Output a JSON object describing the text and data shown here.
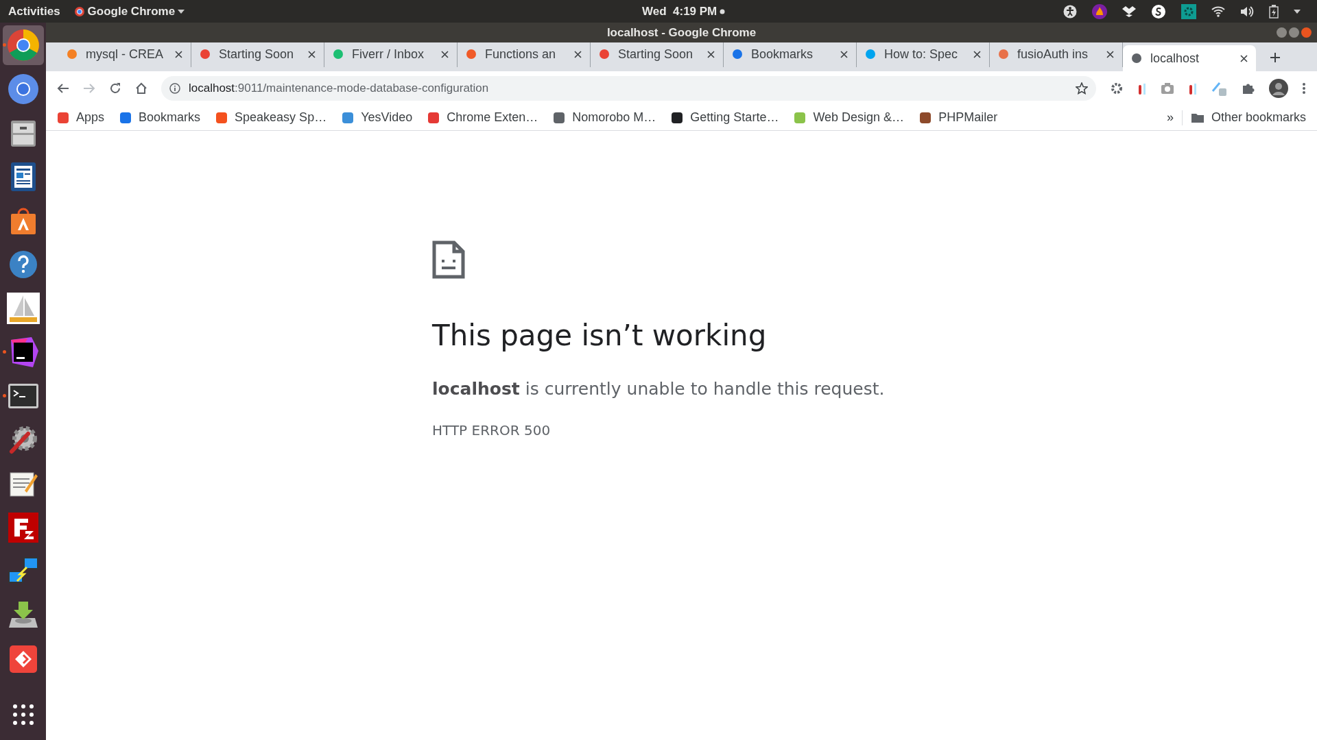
{
  "top_bar": {
    "activities": "Activities",
    "app_menu": "Google Chrome",
    "clock": "Wed  4:19 PM"
  },
  "dock": [
    {
      "kind": "browser",
      "selected": true,
      "running": true
    },
    {
      "kind": "browser2",
      "selected": false,
      "running": false
    },
    {
      "kind": "cabinet",
      "selected": false,
      "running": false
    },
    {
      "kind": "document",
      "selected": false,
      "running": false
    },
    {
      "kind": "store",
      "selected": false,
      "running": false
    },
    {
      "kind": "help",
      "selected": false,
      "running": false
    },
    {
      "kind": "sail",
      "selected": false,
      "running": false
    },
    {
      "kind": "editor",
      "selected": false,
      "running": true
    },
    {
      "kind": "terminal",
      "selected": false,
      "running": true
    },
    {
      "kind": "tools",
      "selected": false,
      "running": false
    },
    {
      "kind": "notepad",
      "selected": false,
      "running": false
    },
    {
      "kind": "ftp",
      "selected": false,
      "running": false
    },
    {
      "kind": "network",
      "selected": false,
      "running": false
    },
    {
      "kind": "download",
      "selected": false,
      "running": false
    },
    {
      "kind": "remote",
      "selected": false,
      "running": false
    },
    {
      "kind": "grid",
      "selected": false,
      "running": false
    }
  ],
  "window": {
    "title": "localhost - Google Chrome"
  },
  "tabs": [
    {
      "label": "mysql - CREA",
      "color": "#f48024",
      "selected": false
    },
    {
      "label": "Starting Soon",
      "color": "#ea4335",
      "selected": false
    },
    {
      "label": "Fiverr / Inbox",
      "color": "#1dbf73",
      "selected": false
    },
    {
      "label": "Functions an",
      "color": "#f05a28",
      "selected": false
    },
    {
      "label": "Starting Soon",
      "color": "#ea4335",
      "selected": false
    },
    {
      "label": "Bookmarks",
      "color": "#1a73e8",
      "selected": false
    },
    {
      "label": "How to: Spec",
      "color": "#00a4ef",
      "selected": false
    },
    {
      "label": "fusioAuth ins",
      "color": "#e8714a",
      "selected": false
    },
    {
      "label": "localhost",
      "color": "#5f6368",
      "selected": true
    }
  ],
  "address_bar": {
    "host": "localhost",
    "path": ":9011/maintenance-mode-database-configuration"
  },
  "bookmarks": [
    {
      "label": "Apps",
      "color": "#ea4335"
    },
    {
      "label": "Bookmarks",
      "color": "#1a73e8"
    },
    {
      "label": "Speakeasy Sp…",
      "color": "#f4511e"
    },
    {
      "label": "YesVideo",
      "color": "#3b8fd9"
    },
    {
      "label": "Chrome Exten…",
      "color": "#e53935"
    },
    {
      "label": "Nomorobo M…",
      "color": "#5f6368"
    },
    {
      "label": "Getting Starte…",
      "color": "#202124"
    },
    {
      "label": "Web Design &…",
      "color": "#8bc34a"
    },
    {
      "label": "PHPMailer",
      "color": "#8d4a2b"
    }
  ],
  "bookmarks_overflow": "»",
  "other_bookmarks": "Other bookmarks",
  "error": {
    "title": "This page isn’t working",
    "message": "**localhost** is currently unable to handle this request.",
    "code": "HTTP ERROR 500"
  }
}
